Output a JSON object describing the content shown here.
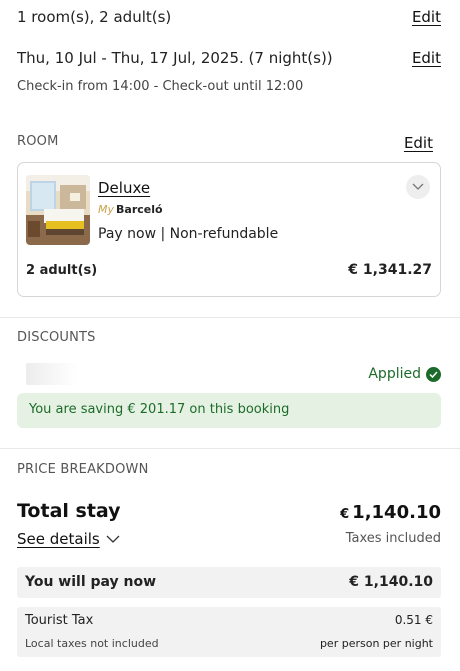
{
  "stay": {
    "rooms_guests": "1 room(s), 2 adult(s)",
    "dates": "Thu, 10 Jul - Thu, 17 Jul, 2025. (7 night(s))",
    "check_times": "Check-in from 14:00 - Check-out until 12:00",
    "edit_label": "Edit"
  },
  "room_section": {
    "label": "ROOM",
    "edit_label": "Edit",
    "room": {
      "name": "Deluxe",
      "brand_prefix": "My",
      "brand": "Barceló",
      "rate": "Pay now | Non-refundable",
      "guests": "2 adult(s)",
      "price": "€ 1,341.27",
      "expand_icon": "chevron-down-icon"
    }
  },
  "discounts": {
    "label": "DISCOUNTS",
    "status": "Applied",
    "status_icon": "check-circle-icon",
    "saving_prefix": "You are saving ",
    "saving_amount": "€ 201.17",
    "saving_suffix": " on this booking"
  },
  "price_breakdown": {
    "label": "PRICE BREAKDOWN",
    "total_label": "Total stay",
    "total_currency": "€",
    "total_value": "1,140.10",
    "see_details": "See details",
    "taxes_note": "Taxes included",
    "pay_now_label": "You will pay now",
    "pay_now_value": "€ 1,140.10",
    "tourist_tax_label": "Tourist Tax",
    "tourist_tax_value": "0.51 €",
    "local_taxes_note": "Local taxes not included",
    "per_person_note": "per person per night"
  },
  "colors": {
    "success": "#1d6b2a",
    "success_bg": "#e5f2e3",
    "muted_bg": "#f2f2f2",
    "brand_gold": "#c9a24a"
  }
}
